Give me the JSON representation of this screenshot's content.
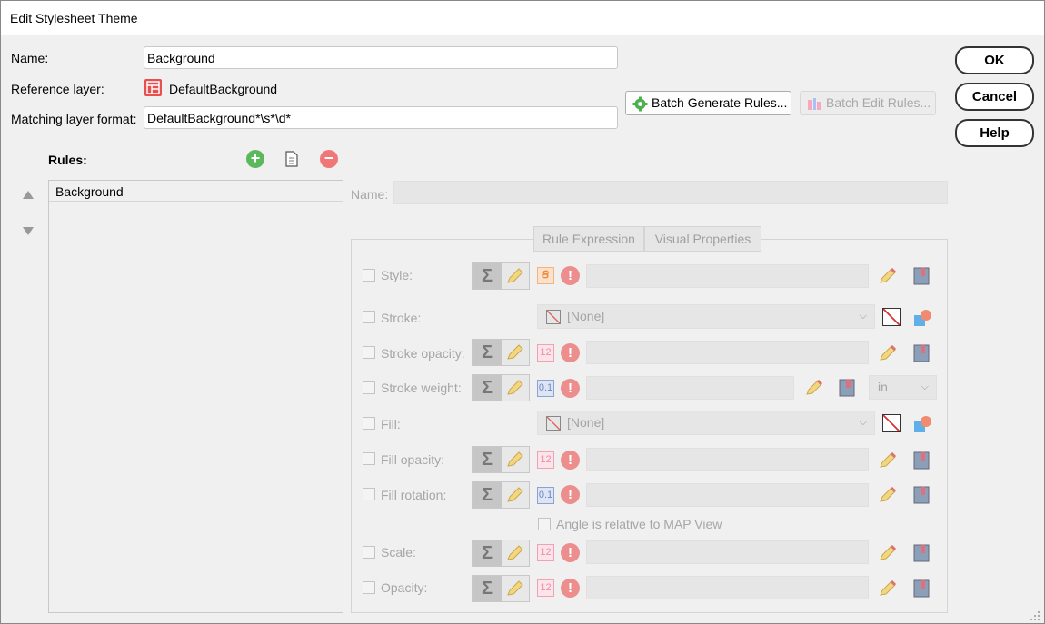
{
  "window": {
    "title": "Edit Stylesheet Theme"
  },
  "form": {
    "name_label": "Name:",
    "name_value": "Background",
    "reference_layer_label": "Reference layer:",
    "reference_layer_value": "DefaultBackground",
    "matching_format_label": "Matching layer format:",
    "matching_format_value": "DefaultBackground*\\s*\\d*"
  },
  "buttons": {
    "ok": "OK",
    "cancel": "Cancel",
    "help": "Help",
    "batch_generate": "Batch Generate Rules...",
    "batch_edit": "Batch Edit Rules..."
  },
  "rules": {
    "label": "Rules:",
    "items": [
      "Background"
    ]
  },
  "rule_editor": {
    "name_label": "Name:",
    "name_value": "",
    "tabs": [
      "Rule Expression",
      "Visual Properties"
    ],
    "properties": [
      {
        "label": "Style:"
      },
      {
        "label": "Stroke:",
        "combo": "[None]"
      },
      {
        "label": "Stroke opacity:"
      },
      {
        "label": "Stroke weight:",
        "unit": "in"
      },
      {
        "label": "Fill:",
        "combo": "[None]"
      },
      {
        "label": "Fill opacity:"
      },
      {
        "label": "Fill rotation:"
      },
      {
        "label": "Scale:"
      },
      {
        "label": "Opacity:"
      }
    ],
    "angle_checkbox_label": "Angle is relative to MAP View",
    "type_icons": {
      "style": "Ꞩ",
      "number": "12",
      "decimal": "0.1"
    },
    "sigma_glyph": "Σ",
    "exclaim_glyph": "!"
  },
  "colors": {
    "add_green": "#5cb85c",
    "remove_red": "#f07777",
    "excl_red": "#ec8e8e",
    "disabled_text": "#a6a6a6"
  },
  "icons": {
    "reference_layer": "layer-table-icon",
    "batch_generate": "gear-icon",
    "batch_edit": "batch-edit-icon",
    "add_rule": "plus-circle-icon",
    "copy_rule": "copy-icon",
    "remove_rule": "minus-circle-icon",
    "move_up": "triangle-up-icon",
    "move_down": "triangle-down-icon"
  }
}
